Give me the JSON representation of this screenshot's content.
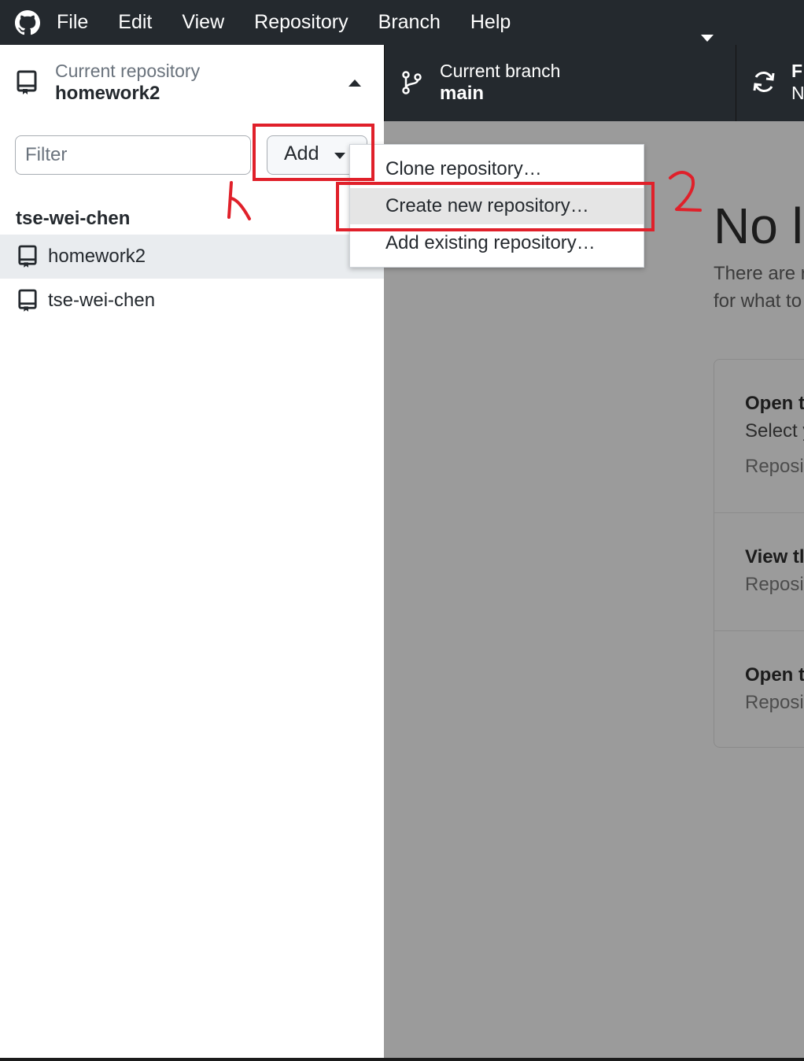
{
  "menubar": {
    "items": [
      "File",
      "Edit",
      "View",
      "Repository",
      "Branch",
      "Help"
    ]
  },
  "toolbar": {
    "repo": {
      "label": "Current repository",
      "value": "homework2"
    },
    "branch": {
      "label": "Current branch",
      "value": "main"
    },
    "fetch": {
      "label": "F",
      "sub": "N"
    }
  },
  "sidebar": {
    "filter_placeholder": "Filter",
    "add_label": "Add",
    "group": "tse-wei-chen",
    "repos": [
      {
        "name": "homework2",
        "selected": true
      },
      {
        "name": "tse-wei-chen",
        "selected": false
      }
    ]
  },
  "dropdown": {
    "items": [
      "Clone repository…",
      "Create new repository…",
      "Add existing repository…"
    ]
  },
  "main": {
    "title": "No l",
    "desc_line1": "There are r",
    "desc_line2": "for what to",
    "cards": [
      {
        "title": "Open t",
        "text": "Select y",
        "muted": "Reposi"
      },
      {
        "title": "View tl",
        "muted": "Reposi"
      },
      {
        "title": "Open t",
        "muted": "Reposi"
      }
    ]
  },
  "annotations": {
    "step1": "1",
    "step2": "2"
  },
  "colors": {
    "chrome_dark": "#24292e",
    "overlay_grey": "#9b9b9b",
    "annotation_red": "#e0202a"
  }
}
